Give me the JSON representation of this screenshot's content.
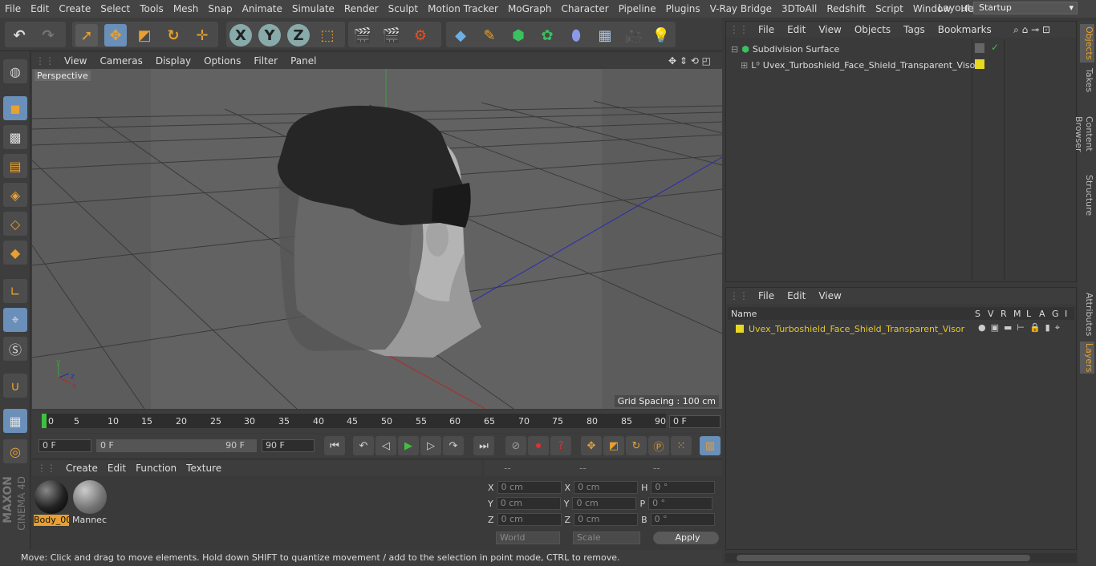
{
  "menu": [
    "File",
    "Edit",
    "Create",
    "Select",
    "Tools",
    "Mesh",
    "Snap",
    "Animate",
    "Simulate",
    "Render",
    "Sculpt",
    "Motion Tracker",
    "MoGraph",
    "Character",
    "Pipeline",
    "Plugins",
    "V-Ray Bridge",
    "3DToAll",
    "Redshift",
    "Script",
    "Window",
    "Help"
  ],
  "layout": {
    "label": "Layout:",
    "value": "Startup"
  },
  "viewport": {
    "menu": [
      "View",
      "Cameras",
      "Display",
      "Options",
      "Filter",
      "Panel"
    ],
    "name": "Perspective",
    "grid_spacing": "Grid Spacing : 100 cm"
  },
  "timeline": {
    "ticks": [
      "0",
      "5",
      "10",
      "15",
      "20",
      "25",
      "30",
      "35",
      "40",
      "45",
      "50",
      "55",
      "60",
      "65",
      "70",
      "75",
      "80",
      "85",
      "90"
    ],
    "current_frame": "0 F"
  },
  "transport": {
    "start": "0 F",
    "range_start": "0 F",
    "range_end": "90 F",
    "end": "90 F"
  },
  "materials": {
    "menu": [
      "Create",
      "Edit",
      "Function",
      "Texture"
    ],
    "items": [
      {
        "name": "Body_00",
        "selected": true
      },
      {
        "name": "Mannec",
        "selected": false
      }
    ]
  },
  "coordinates": {
    "headers": [
      "--",
      "--",
      "--"
    ],
    "rows": [
      {
        "a": "X",
        "av": "0 cm",
        "b": "X",
        "bv": "0 cm",
        "c": "H",
        "cv": "0 °"
      },
      {
        "a": "Y",
        "av": "0 cm",
        "b": "Y",
        "bv": "0 cm",
        "c": "P",
        "cv": "0 °"
      },
      {
        "a": "Z",
        "av": "0 cm",
        "b": "Z",
        "bv": "0 cm",
        "c": "B",
        "cv": "0 °"
      }
    ],
    "world": "World",
    "scale": "Scale",
    "apply": "Apply"
  },
  "status": "Move: Click and drag to move elements. Hold down SHIFT to quantize movement / add to the selection in point mode, CTRL to remove.",
  "objects": {
    "menu": [
      "File",
      "Edit",
      "View",
      "Objects",
      "Tags",
      "Bookmarks"
    ],
    "items": [
      "Subdivision Surface",
      "Uvex_Turboshield_Face_Shield_Transparent_Visor"
    ]
  },
  "layers": {
    "menu": [
      "File",
      "Edit",
      "View"
    ],
    "name_header": "Name",
    "flags": [
      "S",
      "V",
      "R",
      "M",
      "L",
      "A",
      "G",
      "I"
    ],
    "row": "Uvex_Turboshield_Face_Shield_Transparent_Visor"
  },
  "right_tabs": [
    "Objects",
    "Takes",
    "Content Browser",
    "Structure",
    "Attributes",
    "Layers"
  ],
  "brand": {
    "line1": "MAXON",
    "line2": "CINEMA 4D"
  },
  "colors": {
    "accent": "#e8a030",
    "selected_blue": "#6a8fb8",
    "layer_yellow": "#e8d820"
  }
}
